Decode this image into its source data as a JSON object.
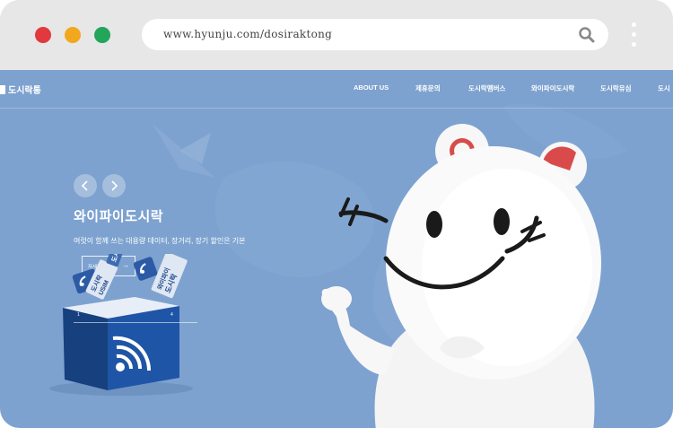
{
  "browser": {
    "url": "www.hyunju.com/dosiraktong",
    "traffic_lights": [
      "#e0393e",
      "#f2a81d",
      "#23a55a"
    ]
  },
  "site": {
    "logo": "도시락통",
    "nav": [
      "ABOUT US",
      "제휴문의",
      "도시락멤버스",
      "와이파이도시락",
      "도시락유심",
      "도시"
    ],
    "hero": {
      "title": "와이파이도시락",
      "subtitle": "여럿이 함께 쓰는 대용량 데이터, 장거리, 장기 할인은 기본",
      "more_label": "자세히보기",
      "more_arrow": "→",
      "page_start": "1",
      "page_end": "4"
    },
    "box": {
      "card_left_line1": "도시락",
      "card_left_line2": "USIM",
      "card_mid": "도시락",
      "card_right_line1": "와이파이",
      "card_right_line2": "도시락"
    },
    "colors": {
      "background": "#7ea2cf",
      "box": "#1d4a93",
      "mascot_ear": "#d94b4b"
    }
  }
}
